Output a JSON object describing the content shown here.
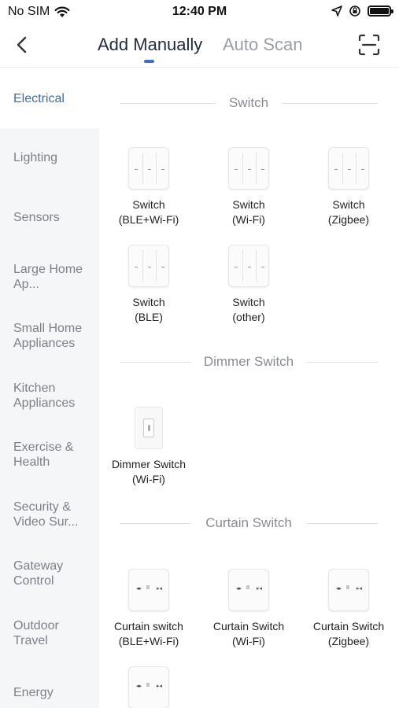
{
  "status_bar": {
    "carrier": "No SIM",
    "time": "12:40 PM"
  },
  "header": {
    "tabs": [
      {
        "label": "Add Manually",
        "active": true
      },
      {
        "label": "Auto Scan",
        "active": false
      }
    ]
  },
  "sidebar": {
    "items": [
      {
        "label": "Electrical",
        "active": true
      },
      {
        "label": "Lighting"
      },
      {
        "label": "Sensors"
      },
      {
        "label": "Large Home Ap..."
      },
      {
        "label": "Small Home Appliances"
      },
      {
        "label": "Kitchen Appliances"
      },
      {
        "label": "Exercise & Health"
      },
      {
        "label": "Security & Video Sur..."
      },
      {
        "label": "Gateway Control"
      },
      {
        "label": "Outdoor Travel"
      },
      {
        "label": "Energy"
      }
    ]
  },
  "sections": [
    {
      "title": "Switch",
      "devices": [
        {
          "line1": "Switch",
          "line2": "(BLE+Wi-Fi)"
        },
        {
          "line1": "Switch",
          "line2": "(Wi-Fi)"
        },
        {
          "line1": "Switch",
          "line2": "(Zigbee)"
        },
        {
          "line1": "Switch",
          "line2": "(BLE)"
        },
        {
          "line1": "Switch",
          "line2": "(other)"
        }
      ]
    },
    {
      "title": "Dimmer Switch",
      "devices": [
        {
          "line1": "Dimmer Switch",
          "line2": "(Wi-Fi)"
        }
      ]
    },
    {
      "title": "Curtain Switch",
      "devices": [
        {
          "line1": "Curtain switch",
          "line2": "(BLE+Wi-Fi)"
        },
        {
          "line1": "Curtain Switch",
          "line2": "(Wi-Fi)"
        },
        {
          "line1": "Curtain Switch",
          "line2": "(Zigbee)"
        },
        {
          "line1": "",
          "line2": ""
        }
      ]
    }
  ],
  "colors": {
    "accent": "#3b6fd8",
    "sidebar_active_text": "#3d6aa8",
    "sidebar_bg": "#f5f6f8"
  },
  "icons": [
    "wifi-icon",
    "location-arrow-icon",
    "orientation-lock-icon",
    "battery-icon",
    "back-chevron-icon",
    "scan-frame-icon"
  ]
}
